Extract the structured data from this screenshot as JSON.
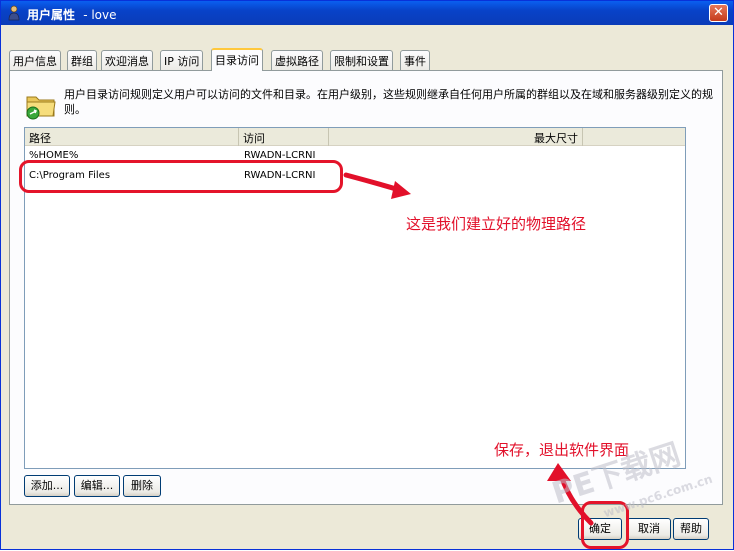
{
  "window": {
    "title": "用户属性",
    "subtitle": "- love",
    "close_glyph": "✕"
  },
  "tabs": [
    {
      "label": "用户信息"
    },
    {
      "label": "群组"
    },
    {
      "label": "欢迎消息"
    },
    {
      "label": "IP 访问"
    },
    {
      "label": "目录访问"
    },
    {
      "label": "虚拟路径"
    },
    {
      "label": "限制和设置"
    },
    {
      "label": "事件"
    }
  ],
  "active_tab": 4,
  "directory_access": {
    "description": "用户目录访问规则定义用户可以访问的文件和目录。在用户级别，这些规则继承自任何用户所属的群组以及在域和服务器级别定义的规则。",
    "columns": {
      "path": "路径",
      "access": "访问",
      "max_size": "最大尺寸"
    },
    "rows": [
      {
        "path": "%HOME%",
        "access": "RWADN-LCRNI",
        "max_size": ""
      },
      {
        "path": "C:\\Program Files",
        "access": "RWADN-LCRNI",
        "max_size": ""
      }
    ],
    "buttons": {
      "add": "添加...",
      "edit": "编辑...",
      "delete": "删除"
    }
  },
  "dialog_buttons": {
    "ok": "确定",
    "cancel": "取消",
    "help": "帮助"
  },
  "annotations": {
    "path_note": "这是我们建立好的物理路径",
    "save_note": "保存，退出软件界面"
  },
  "watermark": {
    "main": "PE下载网",
    "sub": "www.pc6.com.cn"
  },
  "colors": {
    "annotation": "#e2102a",
    "titlebar": "#0842c8",
    "tab_active_accent": "#ffc83c"
  }
}
